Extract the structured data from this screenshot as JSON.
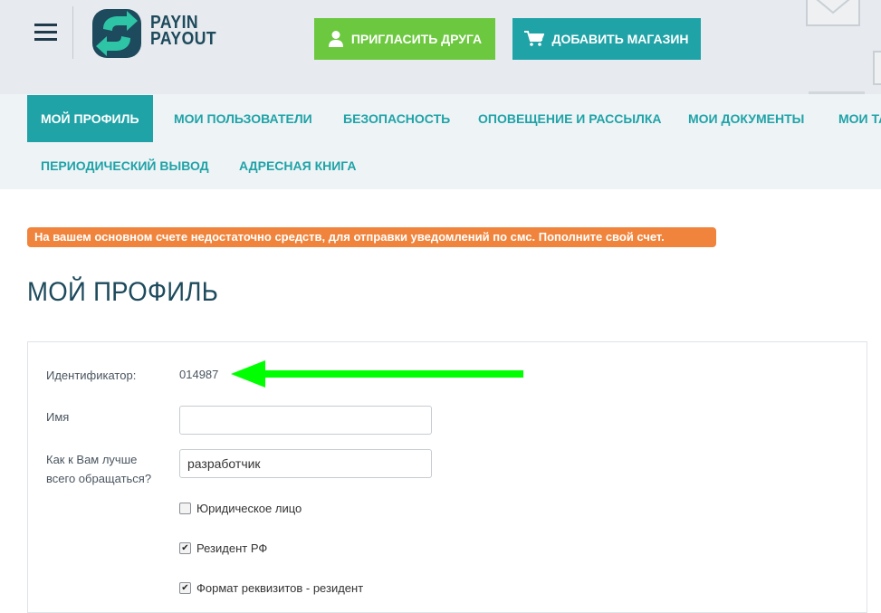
{
  "header": {
    "logo_line1": "PAYIN",
    "logo_line2": "PAYOUT",
    "invite_button": "ПРИГЛАСИТЬ ДРУГА",
    "add_shop_button": "ДОБАВИТЬ МАГАЗИН"
  },
  "nav": {
    "items": [
      {
        "label": "МОЙ ПРОФИЛЬ",
        "active": true
      },
      {
        "label": "МОИ ПОЛЬЗОВАТЕЛИ"
      },
      {
        "label": "БЕЗОПАСНОСТЬ"
      },
      {
        "label": "ОПОВЕЩЕНИЕ И РАССЫЛКА"
      },
      {
        "label": "МОИ ДОКУМЕНТЫ"
      },
      {
        "label": "МОИ ТА"
      },
      {
        "label": "ПЕРИОДИЧЕСКИЙ ВЫВОД"
      },
      {
        "label": "АДРЕСНАЯ КНИГА"
      }
    ]
  },
  "alert": "На вашем основном счете недостаточно средств, для отправки уведомлений по смс. Пополните свой счет.",
  "page_title": "МОЙ ПРОФИЛЬ",
  "profile": {
    "id_label": "Идентификатор:",
    "id_value": "014987",
    "name_label": "Имя",
    "name_value": "",
    "address_label_line1": "Как к Вам лучше",
    "address_label_line2": "всего обращаться?",
    "address_value": "разработчик",
    "checkboxes": [
      {
        "label": "Юридическое лицо",
        "checked": false
      },
      {
        "label": "Резидент РФ",
        "checked": true
      },
      {
        "label": "Формат реквизитов - резидент",
        "checked": true
      }
    ]
  },
  "colors": {
    "teal": "#1fa3a7",
    "green": "#6cc83e",
    "alert": "#f0843c",
    "annotation_arrow": "#00ff00",
    "title": "#1d4a5c"
  }
}
